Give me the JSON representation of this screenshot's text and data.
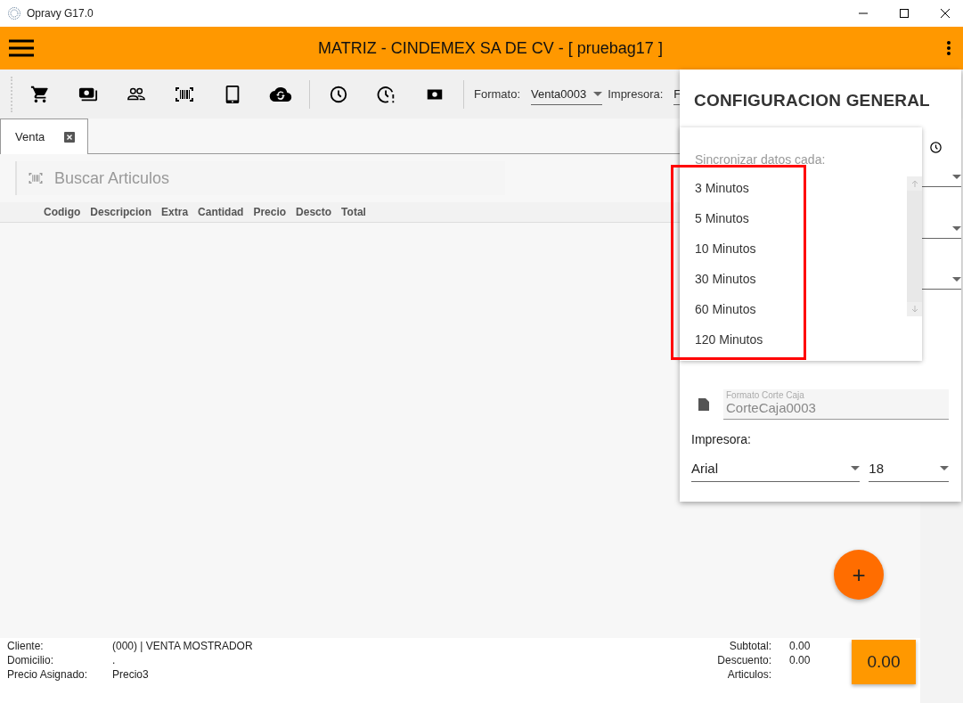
{
  "window": {
    "title": "Opravy G17.0"
  },
  "header": {
    "title": "MATRIZ - CINDEMEX SA DE CV - [ pruebag17 ]"
  },
  "toolbar": {
    "format_label": "Formato:",
    "format_value": "Venta0003",
    "printer_label": "Impresora:",
    "printer_value": "F"
  },
  "tabs": [
    {
      "label": "Venta",
      "selected": true
    }
  ],
  "search": {
    "placeholder": "Buscar Articulos"
  },
  "table": {
    "columns": [
      "Codigo",
      "Descripcion",
      "Extra",
      "Cantidad",
      "Precio",
      "Descto",
      "Total"
    ]
  },
  "fab": {
    "label": "+"
  },
  "footer": {
    "info": [
      {
        "label": "Cliente:",
        "value": "(000) | VENTA MOSTRADOR"
      },
      {
        "label": "Domicilio:",
        "value": "."
      },
      {
        "label": "Precio Asignado:",
        "value": "Precio3"
      }
    ],
    "totals": [
      {
        "label": "Subtotal:",
        "value": "0.00"
      },
      {
        "label": "Descuento:",
        "value": "0.00"
      },
      {
        "label": "Articulos:"
      }
    ],
    "total": "0.00"
  },
  "panel": {
    "title": "CONFIGURACION GENERAL",
    "dropdown": {
      "label": "Sincronizar datos cada:",
      "options": [
        "3 Minutos",
        "5 Minutos",
        "10 Minutos",
        "30 Minutos",
        "60 Minutos",
        "120 Minutos"
      ]
    },
    "cut_format": {
      "label": "Formato Corte Caja",
      "value": "CorteCaja0003"
    },
    "printer_label": "Impresora:",
    "font": "Arial",
    "size": "18"
  }
}
